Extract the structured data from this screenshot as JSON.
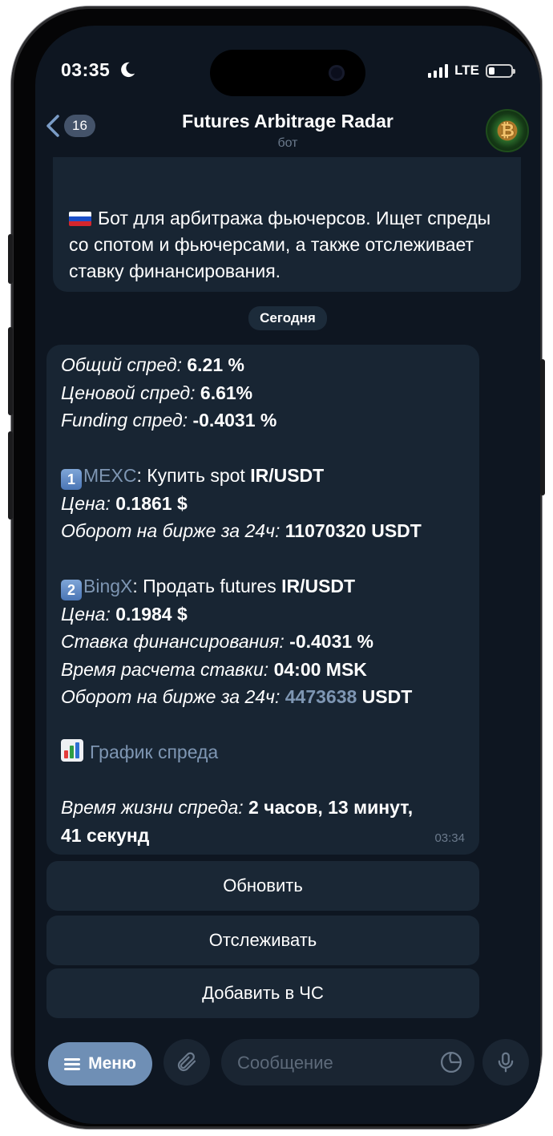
{
  "status": {
    "time": "03:35",
    "network": "LTE"
  },
  "header": {
    "back_count": "16",
    "title": "Futures Arbitrage Radar",
    "subtitle": "бот",
    "avatar_glyph": "₿"
  },
  "intro": {
    "text": "Бот для арбитража фьючерсов. Ищет спреды со спотом и фьючерсами, а также отслеживает ставку финансирования."
  },
  "date_separator": "Сегодня",
  "message": {
    "l1_label": "Общий спред:",
    "l1_value": "6.21 %",
    "l2_label": "Ценовой спред:",
    "l2_value": "6.61%",
    "l3_label": "Funding спред:",
    "l3_value": "-0.4031 %",
    "ex1_key": "1",
    "ex1_name": "MEXC",
    "ex1_action": ": Купить spot ",
    "ex1_pair": "IR/USDT",
    "ex1_price_label": "Цена:",
    "ex1_price": "0.1861 $",
    "ex1_turnover_label": "Оборот на бирже за 24ч:",
    "ex1_turnover": "11070320 USDT",
    "ex2_key": "2",
    "ex2_name": "BingX",
    "ex2_action": ": Продать futures ",
    "ex2_pair": "IR/USDT",
    "ex2_price_label": "Цена:",
    "ex2_price": "0.1984 $",
    "ex2_funding_label": "Ставка финансирования:",
    "ex2_funding": "-0.4031 %",
    "ex2_time_label": "Время расчета ставки:",
    "ex2_time": "04:00 MSK",
    "ex2_turnover_label": "Оборот на бирже за 24ч:",
    "ex2_turnover_num": "4473638",
    "ex2_turnover_unit": " USDT",
    "chart_link": "График спреда",
    "life_label": "Время жизни спреда:",
    "life_value_1": "2 часов, 13 минут,",
    "life_value_2": "41 секунд",
    "timestamp": "03:34"
  },
  "keyboard": {
    "refresh": "Обновить",
    "track": "Отслеживать",
    "blacklist": "Добавить в ЧС"
  },
  "input": {
    "menu_label": "Меню",
    "placeholder": "Сообщение"
  },
  "colors": {
    "background": "#0e1621",
    "bubble": "#182533",
    "link": "#7e96b3",
    "menu_button": "#6f8fb5"
  }
}
